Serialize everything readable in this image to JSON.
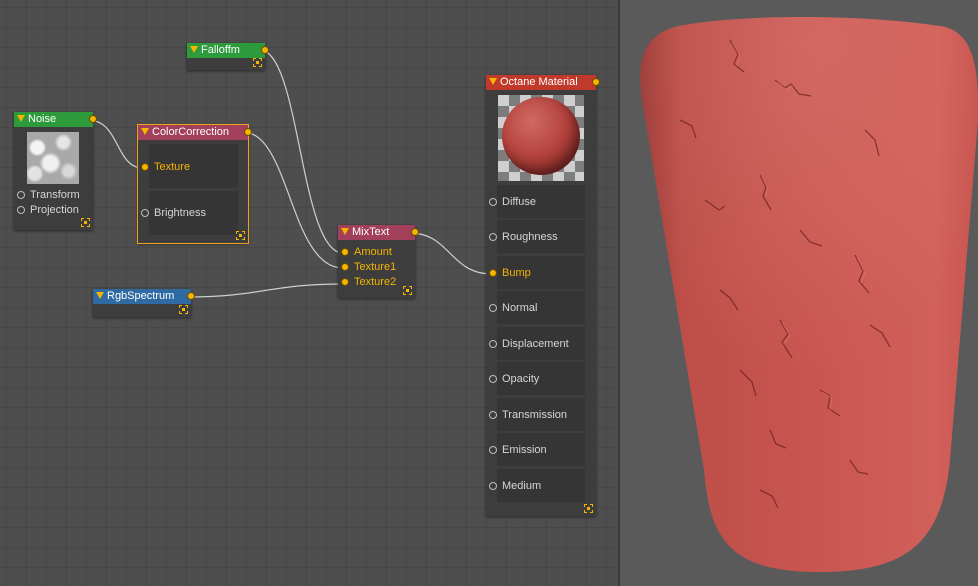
{
  "nodes": {
    "falloff": {
      "title": "Falloffm"
    },
    "noise": {
      "title": "Noise",
      "inputs": [
        "Transform",
        "Projection"
      ]
    },
    "colorcorrection": {
      "title": "ColorCorrection",
      "inputs": [
        "Texture",
        "Brightness"
      ]
    },
    "mixtext": {
      "title": "MixText",
      "inputs": [
        "Amount",
        "Texture1",
        "Texture2"
      ]
    },
    "rgbspectrum": {
      "title": "RgbSpectrum"
    },
    "octane": {
      "title": "Octane Material",
      "inputs": [
        "Diffuse",
        "Roughness",
        "Bump",
        "Normal",
        "Displacement",
        "Opacity",
        "Transmission",
        "Emission",
        "Medium"
      ]
    }
  },
  "colors": {
    "accent_orange": "#f5b400",
    "node_green": "#2d9a3c",
    "node_pink": "#a23f5a",
    "node_blue": "#2f6aa2",
    "node_red": "#c0392b",
    "material_red": "#c9554f"
  },
  "icons": {
    "collapse": "triangle-down-icon",
    "resize": "resize-corner-icon",
    "output": "output-dot-icon"
  }
}
